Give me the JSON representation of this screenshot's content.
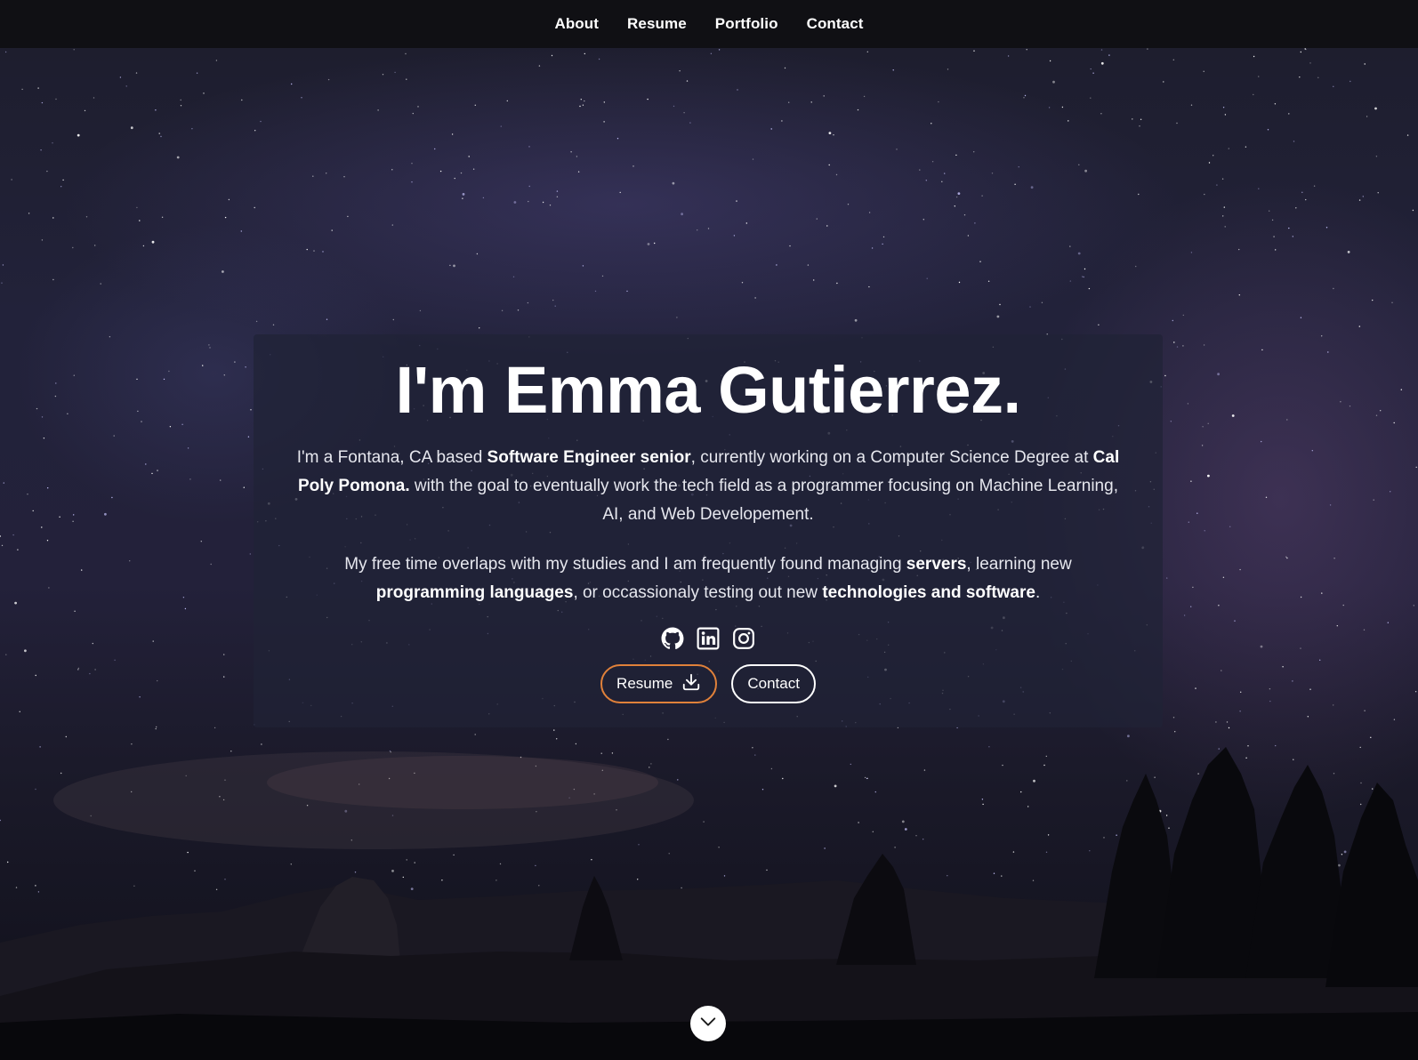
{
  "nav": {
    "items": [
      {
        "label": "About"
      },
      {
        "label": "Resume"
      },
      {
        "label": "Portfolio"
      },
      {
        "label": "Contact"
      }
    ]
  },
  "hero": {
    "title": "I'm Emma Gutierrez.",
    "intro": {
      "t1": "I'm a Fontana, CA based ",
      "b1": "Software Engineer senior",
      "t2": ", currently working on a Computer Science Degree at ",
      "b2": "Cal Poly Pomona.",
      "t3": " with the goal to eventually work the tech field as a programmer focusing on Machine Learning, AI, and Web Developement."
    },
    "free_time": {
      "t1": "My free time overlaps with my studies and I am frequently found managing ",
      "b1": "servers",
      "t2": ", learning new ",
      "b2": "programming languages",
      "t3": ", or occassionaly testing out new ",
      "b3": "technologies and software",
      "t4": "."
    },
    "social_icons": [
      "github-icon",
      "linkedin-icon",
      "instagram-icon"
    ],
    "buttons": {
      "resume_label": "Resume",
      "contact_label": "Contact"
    }
  },
  "colors": {
    "accent": "#e0813a",
    "nav_bg": "#101014",
    "card_bg": "#202236"
  }
}
